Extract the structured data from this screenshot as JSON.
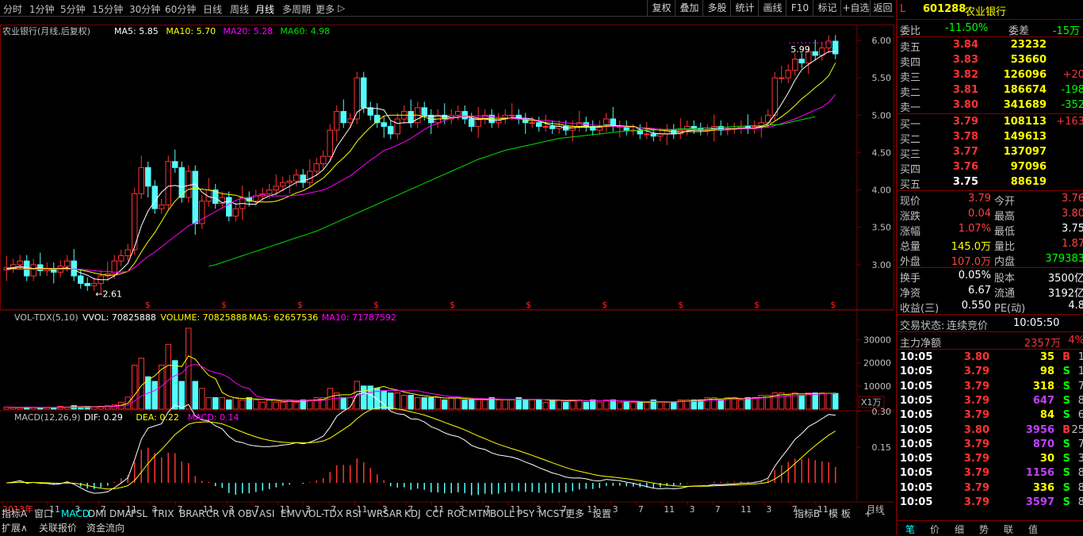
{
  "toolbar": {
    "periods": [
      "分时",
      "1分钟",
      "5分钟",
      "15分钟",
      "30分钟",
      "60分钟",
      "日线",
      "周线",
      "月线",
      "多周期",
      "更多"
    ],
    "active_period": "月线",
    "more_arrow": "▷",
    "right_buttons": [
      "复权",
      "叠加",
      "多股",
      "统计",
      "画线",
      "F10",
      "标记",
      "+自选",
      "返回"
    ]
  },
  "price_panel": {
    "title": "农业银行(月线,后复权)",
    "ma_labels": [
      "MA5: 5.85",
      "MA10: 5.70",
      "MA20: 5.28",
      "MA60: 4.98"
    ],
    "ma_colors": [
      "#ffffff",
      "#ffff00",
      "#ff00ff",
      "#00e000"
    ],
    "y_ticks": [
      "6.00",
      "5.50",
      "5.00",
      "4.50",
      "4.00",
      "3.50",
      "3.00"
    ],
    "high_mark": "5.99",
    "low_mark": "2.61",
    "dividend_marker": "$"
  },
  "volume_panel": {
    "title": "VOL-TDX(5,10)",
    "labels": [
      "VVOL: 70825888",
      "VOLUME: 70825888",
      "MA5: 62657536",
      "MA10: 71787592"
    ],
    "label_colors": [
      "#ffffff",
      "#ffff00",
      "#ffff00",
      "#ff00ff"
    ],
    "y_ticks": [
      "30000",
      "20000",
      "10000"
    ],
    "unit": "X1万"
  },
  "macd_panel": {
    "title": "MACD(12,26,9)",
    "labels": [
      "DIF: 0.29",
      "DEA: 0.22",
      "MACD: 0.14"
    ],
    "label_colors": [
      "#ffffff",
      "#ffff00",
      "#ff00ff"
    ],
    "y_ticks": [
      "0.30",
      "0.15"
    ]
  },
  "x_axis": {
    "labels": [
      "2013年",
      "11",
      "3",
      "7",
      "11",
      "3",
      "7",
      "11",
      "3",
      "7",
      "11",
      "3",
      "7",
      "11",
      "3",
      "7",
      "11",
      "3",
      "7",
      "11",
      "3",
      "7",
      "11",
      "3",
      "7",
      "11",
      "3",
      "7",
      "11",
      "3",
      "7",
      "11"
    ],
    "period_label": "月线"
  },
  "bottom_tabs": {
    "row1": [
      "指标A",
      "窗口",
      "MACD",
      "DMI",
      "DMA",
      "FSL",
      "TRIX",
      "BRAR",
      "CR",
      "VR",
      "OBV",
      "ASI",
      "EMV",
      "VOL-TDX",
      "RSI",
      "WR",
      "SAR",
      "KDJ",
      "CCI",
      "ROC",
      "MTM",
      "BOLL",
      "PSY",
      "MCST",
      "更多",
      "设置"
    ],
    "active": "MACD",
    "right": [
      "指标B",
      "模 板",
      "+",
      "-"
    ],
    "row2": [
      "扩展∧",
      "关联报价",
      "资金流向"
    ]
  },
  "quote": {
    "code": "601288",
    "name": "农业银行",
    "prefix": "L",
    "weibi_label": "委比",
    "weibi": "-11.50%",
    "weicha_label": "委差",
    "weicha": "-15万",
    "asks": [
      {
        "label": "卖五",
        "price": "3.84",
        "vol": "23232",
        "chg": ""
      },
      {
        "label": "卖四",
        "price": "3.83",
        "vol": "53660",
        "chg": ""
      },
      {
        "label": "卖三",
        "price": "3.82",
        "vol": "126096",
        "chg": "+20"
      },
      {
        "label": "卖二",
        "price": "3.81",
        "vol": "186674",
        "chg": "-198"
      },
      {
        "label": "卖一",
        "price": "3.80",
        "vol": "341689",
        "chg": "-352"
      }
    ],
    "bids": [
      {
        "label": "买一",
        "price": "3.79",
        "vol": "108113",
        "chg": "+163"
      },
      {
        "label": "买二",
        "price": "3.78",
        "vol": "149613",
        "chg": ""
      },
      {
        "label": "买三",
        "price": "3.77",
        "vol": "137097",
        "chg": ""
      },
      {
        "label": "买四",
        "price": "3.76",
        "vol": "97096",
        "chg": ""
      },
      {
        "label": "买五",
        "price": "3.75",
        "vol": "88619",
        "chg": ""
      }
    ],
    "stats": [
      {
        "l1": "现价",
        "v1": "3.79",
        "l2": "今开",
        "v2": "3.76",
        "c1": "#ff4040",
        "c2": "#ff4040"
      },
      {
        "l1": "涨跌",
        "v1": "0.04",
        "l2": "最高",
        "v2": "3.80",
        "c1": "#ff4040",
        "c2": "#ff4040"
      },
      {
        "l1": "涨幅",
        "v1": "1.07%",
        "l2": "最低",
        "v2": "3.75",
        "c1": "#ff4040",
        "c2": "#ffffff"
      },
      {
        "l1": "总量",
        "v1": "145.0万",
        "l2": "量比",
        "v2": "1.87",
        "c1": "#ffff00",
        "c2": "#ff4040"
      },
      {
        "l1": "外盘",
        "v1": "107.0万",
        "l2": "内盘",
        "v2": "379383",
        "c1": "#ff4040",
        "c2": "#00ff00"
      }
    ],
    "stats2": [
      {
        "l1": "换手",
        "v1": "0.05%",
        "l2": "股本",
        "v2": "3500亿"
      },
      {
        "l1": "净资",
        "v1": "6.67",
        "l2": "流通",
        "v2": "3192亿"
      },
      {
        "l1": "收益(三)",
        "v1": "0.550",
        "l2": "PE(动)",
        "v2": "4.8"
      }
    ],
    "trade_status_label": "交易状态:",
    "trade_status": "连续竞价",
    "trade_time": "10:05:50",
    "main_flow_label": "主力净额",
    "main_flow": "2357万",
    "main_flow_pct": "4%",
    "ticks": [
      {
        "t": "10:05",
        "p": "3.80",
        "v": "35",
        "bs": "B",
        "n": "1"
      },
      {
        "t": "10:05",
        "p": "3.79",
        "v": "98",
        "bs": "S",
        "n": "1"
      },
      {
        "t": "10:05",
        "p": "3.79",
        "v": "318",
        "bs": "S",
        "n": "7"
      },
      {
        "t": "10:05",
        "p": "3.79",
        "v": "647",
        "bs": "S",
        "n": "8"
      },
      {
        "t": "10:05",
        "p": "3.79",
        "v": "84",
        "bs": "S",
        "n": "6"
      },
      {
        "t": "10:05",
        "p": "3.80",
        "v": "3956",
        "bs": "B",
        "n": "25"
      },
      {
        "t": "10:05",
        "p": "3.79",
        "v": "870",
        "bs": "S",
        "n": "7"
      },
      {
        "t": "10:05",
        "p": "3.79",
        "v": "30",
        "bs": "S",
        "n": "3"
      },
      {
        "t": "10:05",
        "p": "3.79",
        "v": "1156",
        "bs": "S",
        "n": "8"
      },
      {
        "t": "10:05",
        "p": "3.79",
        "v": "336",
        "bs": "S",
        "n": "8"
      },
      {
        "t": "10:05",
        "p": "3.79",
        "v": "3597",
        "bs": "S",
        "n": "8"
      }
    ],
    "bottom_tabs": [
      "笔",
      "价",
      "细",
      "势",
      "联",
      "值"
    ]
  },
  "chart_data": {
    "type": "candlestick",
    "close": [
      2.96,
      3.0,
      3.05,
      2.85,
      3.0,
      2.92,
      2.95,
      2.9,
      2.98,
      3.05,
      2.85,
      2.75,
      2.72,
      2.75,
      2.85,
      2.88,
      3.05,
      3.12,
      3.2,
      3.95,
      4.3,
      4.05,
      3.75,
      3.8,
      4.38,
      4.3,
      3.9,
      4.25,
      3.55,
      3.85,
      4.0,
      3.82,
      3.9,
      3.65,
      3.75,
      3.9,
      3.85,
      3.92,
      3.95,
      4.0,
      4.05,
      4.1,
      4.12,
      4.2,
      4.1,
      4.25,
      4.35,
      4.45,
      4.8,
      5.05,
      4.9,
      4.95,
      5.5,
      5.1,
      5.0,
      4.9,
      4.85,
      4.75,
      4.95,
      5.05,
      4.9,
      5.1,
      5.0,
      4.9,
      5.0,
      4.95,
      5.0,
      5.05,
      4.95,
      4.85,
      4.95,
      5.0,
      4.9,
      4.95,
      5.0,
      5.0,
      4.95,
      4.9,
      4.9,
      4.85,
      4.85,
      4.82,
      4.85,
      4.8,
      4.85,
      4.9,
      4.85,
      4.8,
      4.85,
      4.95,
      4.85,
      4.85,
      4.8,
      4.8,
      4.75,
      4.75,
      4.72,
      4.75,
      4.8,
      4.75,
      4.8,
      4.85,
      4.82,
      4.8,
      4.8,
      4.85,
      4.8,
      4.82,
      4.82,
      4.85,
      4.82,
      4.85,
      4.9,
      5.0,
      5.5,
      5.5,
      5.6,
      5.75,
      5.7,
      5.85,
      5.8,
      5.9,
      5.99,
      5.82
    ],
    "ma5": [
      2.95,
      2.96,
      2.98,
      2.96,
      2.95,
      2.96,
      2.94,
      2.93,
      2.95,
      2.96,
      2.93,
      2.89,
      2.86,
      2.81,
      2.8,
      2.8,
      2.85,
      2.93,
      3.02,
      3.24,
      3.52,
      3.72,
      3.85,
      3.97,
      4.05,
      4.06,
      4.04,
      4.06,
      4.08,
      3.97,
      3.91,
      3.89,
      3.83,
      3.85,
      3.81,
      3.82,
      3.81,
      3.81,
      3.88,
      3.92,
      3.95,
      4.0,
      4.05,
      4.1,
      4.12,
      4.15,
      4.2,
      4.27,
      4.39,
      4.58,
      4.71,
      4.84,
      5.04,
      5.1,
      5.09,
      5.09,
      5.07,
      4.93,
      4.89,
      4.9,
      4.9,
      4.95,
      4.99,
      4.99,
      4.99,
      4.99,
      4.97,
      4.98,
      4.99,
      4.96,
      4.94,
      4.95,
      4.93,
      4.93,
      4.95,
      4.97,
      4.96,
      4.96,
      4.95,
      4.92,
      4.89,
      4.86,
      4.85,
      4.83,
      4.83,
      4.84,
      4.84,
      4.84,
      4.85,
      4.87,
      4.86,
      4.86,
      4.85,
      4.85,
      4.81,
      4.79,
      4.76,
      4.75,
      4.75,
      4.75,
      4.76,
      4.79,
      4.8,
      4.8,
      4.81,
      4.82,
      4.81,
      4.82,
      4.82,
      4.83,
      4.82,
      4.83,
      4.85,
      4.89,
      5.01,
      5.15,
      5.3,
      5.47,
      5.61,
      5.68,
      5.74,
      5.8,
      5.85,
      5.85
    ],
    "ma10": [
      2.94,
      2.95,
      2.96,
      2.95,
      2.95,
      2.95,
      2.95,
      2.95,
      2.95,
      2.95,
      2.94,
      2.93,
      2.91,
      2.89,
      2.87,
      2.86,
      2.86,
      2.88,
      2.91,
      3.02,
      3.17,
      3.31,
      3.43,
      3.58,
      3.73,
      3.85,
      3.94,
      4.01,
      4.02,
      4.01,
      4.0,
      3.98,
      3.95,
      3.94,
      3.93,
      3.9,
      3.86,
      3.84,
      3.84,
      3.84,
      3.85,
      3.88,
      3.92,
      3.96,
      3.99,
      4.04,
      4.1,
      4.16,
      4.25,
      4.35,
      4.43,
      4.52,
      4.65,
      4.75,
      4.84,
      4.92,
      4.99,
      5.0,
      5.0,
      5.0,
      5.0,
      5.0,
      4.98,
      4.94,
      4.95,
      4.95,
      4.96,
      4.97,
      4.99,
      4.98,
      4.96,
      4.96,
      4.95,
      4.95,
      4.96,
      4.96,
      4.95,
      4.94,
      4.93,
      4.92,
      4.9,
      4.89,
      4.88,
      4.86,
      4.85,
      4.85,
      4.85,
      4.84,
      4.84,
      4.85,
      4.85,
      4.85,
      4.85,
      4.85,
      4.83,
      4.82,
      4.81,
      4.8,
      4.79,
      4.78,
      4.78,
      4.78,
      4.78,
      4.78,
      4.79,
      4.8,
      4.81,
      4.81,
      4.82,
      4.82,
      4.82,
      4.83,
      4.84,
      4.86,
      4.92,
      4.98,
      5.05,
      5.13,
      5.22,
      5.29,
      5.37,
      5.44,
      5.53,
      5.7
    ],
    "ma20": [
      2.93,
      2.94,
      2.94,
      2.94,
      2.94,
      2.94,
      2.94,
      2.94,
      2.94,
      2.94,
      2.94,
      2.94,
      2.93,
      2.92,
      2.91,
      2.91,
      2.9,
      2.9,
      2.91,
      2.96,
      3.04,
      3.11,
      3.17,
      3.24,
      3.31,
      3.38,
      3.45,
      3.52,
      3.56,
      3.61,
      3.66,
      3.71,
      3.76,
      3.81,
      3.86,
      3.89,
      3.9,
      3.92,
      3.94,
      3.92,
      3.92,
      3.92,
      3.92,
      3.93,
      3.94,
      3.96,
      3.98,
      4.0,
      4.04,
      4.09,
      4.14,
      4.19,
      4.26,
      4.33,
      4.4,
      4.46,
      4.53,
      4.56,
      4.6,
      4.64,
      4.69,
      4.75,
      4.81,
      4.86,
      4.89,
      4.93,
      4.96,
      4.98,
      4.99,
      4.99,
      4.99,
      4.99,
      4.98,
      4.97,
      4.97,
      4.96,
      4.95,
      4.95,
      4.94,
      4.93,
      4.93,
      4.92,
      4.91,
      4.9,
      4.89,
      4.89,
      4.88,
      4.87,
      4.86,
      4.86,
      4.85,
      4.85,
      4.84,
      4.84,
      4.83,
      4.83,
      4.82,
      4.81,
      4.81,
      4.81,
      4.81,
      4.81,
      4.81,
      4.81,
      4.81,
      4.81,
      4.81,
      4.81,
      4.81,
      4.82,
      4.82,
      4.82,
      4.83,
      4.84,
      4.86,
      4.89,
      4.92,
      4.95,
      4.99,
      5.03,
      5.07,
      5.11,
      5.17,
      5.28
    ],
    "ma60_start": 30,
    "ma60": [
      2.98,
      3.0,
      3.03,
      3.06,
      3.09,
      3.12,
      3.15,
      3.18,
      3.21,
      3.24,
      3.27,
      3.3,
      3.33,
      3.36,
      3.39,
      3.42,
      3.45,
      3.49,
      3.53,
      3.57,
      3.61,
      3.65,
      3.69,
      3.73,
      3.77,
      3.81,
      3.85,
      3.89,
      3.93,
      3.97,
      4.01,
      4.05,
      4.09,
      4.13,
      4.17,
      4.21,
      4.25,
      4.29,
      4.33,
      4.37,
      4.41,
      4.44,
      4.47,
      4.5,
      4.53,
      4.55,
      4.57,
      4.59,
      4.61,
      4.63,
      4.65,
      4.67,
      4.69,
      4.7,
      4.71,
      4.72,
      4.73,
      4.74,
      4.75,
      4.76,
      4.77,
      4.78,
      4.79,
      4.79,
      4.8,
      4.8,
      4.8,
      4.81,
      4.81,
      4.81,
      4.82,
      4.82,
      4.82,
      4.83,
      4.83,
      4.83,
      4.84,
      4.84,
      4.85,
      4.85,
      4.86,
      4.86,
      4.86,
      4.87,
      4.87,
      4.88,
      4.9,
      4.92,
      4.94,
      4.96,
      4.98
    ],
    "volume": [
      900,
      700,
      800,
      600,
      700,
      650,
      800,
      700,
      1200,
      900,
      1500,
      800,
      1100,
      900,
      1200,
      1500,
      1800,
      3000,
      5200,
      19000,
      22000,
      14000,
      12000,
      19000,
      28000,
      21000,
      12000,
      35000,
      12000,
      9000,
      5000,
      5000,
      5000,
      4000,
      5000,
      4000,
      5000,
      4000,
      3000,
      4000,
      3000,
      3000,
      4000,
      3000,
      4000,
      4000,
      5000,
      5000,
      9000,
      7000,
      5000,
      5000,
      12000,
      10000,
      10000,
      9000,
      8000,
      7000,
      7000,
      6000,
      6000,
      5000,
      5000,
      5000,
      5000,
      4000,
      5000,
      5000,
      4000,
      4000,
      4000,
      4000,
      5000,
      4000,
      4000,
      4000,
      5000,
      4000,
      4000,
      4000,
      3000,
      4000,
      4000,
      3000,
      4000,
      4000,
      3000,
      4000,
      3000,
      4000,
      4000,
      3000,
      3000,
      3000,
      3000,
      3000,
      4000,
      3000,
      3000,
      3000,
      4000,
      4000,
      4000,
      4000,
      5000,
      5000,
      4000,
      5000,
      5000,
      4000,
      5000,
      5000,
      6000,
      6000,
      7000,
      7000,
      6000,
      7000,
      6000,
      7000,
      7000,
      7000,
      6800,
      6800
    ],
    "macd": {
      "dif_last": 0.29,
      "dea_last": 0.22,
      "macd_last": 0.14
    }
  }
}
